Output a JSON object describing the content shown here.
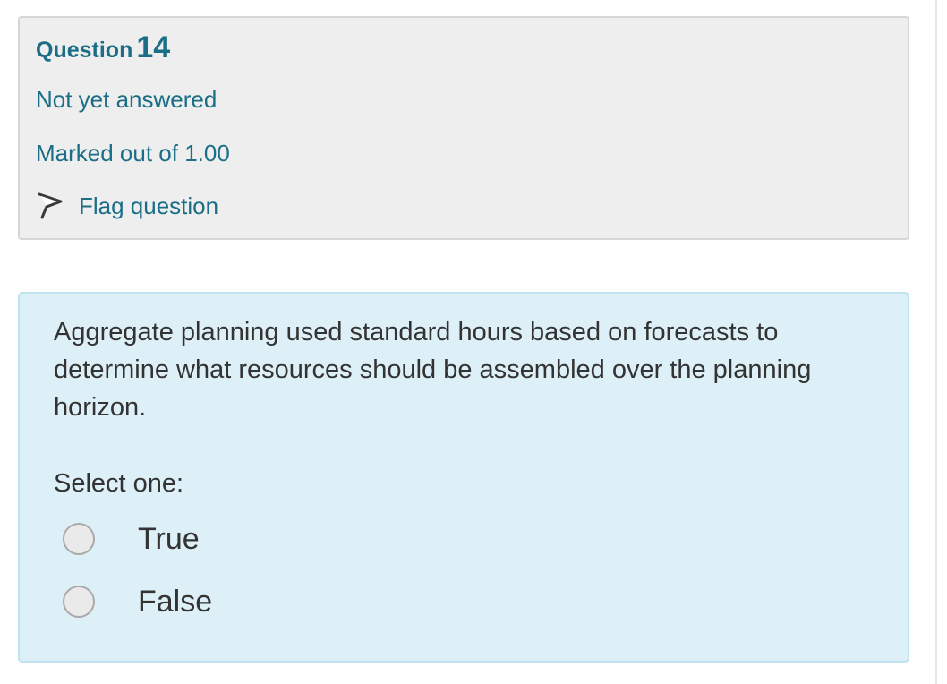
{
  "question_info": {
    "label": "Question",
    "number": "14",
    "state": "Not yet answered",
    "grade": "Marked out of 1.00",
    "flag_label": "Flag question"
  },
  "question": {
    "text": "Aggregate planning used standard hours based on forecasts to determine what resources should be assembled over the planning horizon.",
    "prompt": "Select one:",
    "options": [
      {
        "label": "True",
        "selected": false
      },
      {
        "label": "False",
        "selected": false
      }
    ]
  },
  "colors": {
    "info_background": "#eeeeee",
    "content_background": "#def0f7",
    "link_accent": "#1b6e86",
    "body_text": "#333333"
  },
  "icons": {
    "flag": "flag-icon"
  }
}
